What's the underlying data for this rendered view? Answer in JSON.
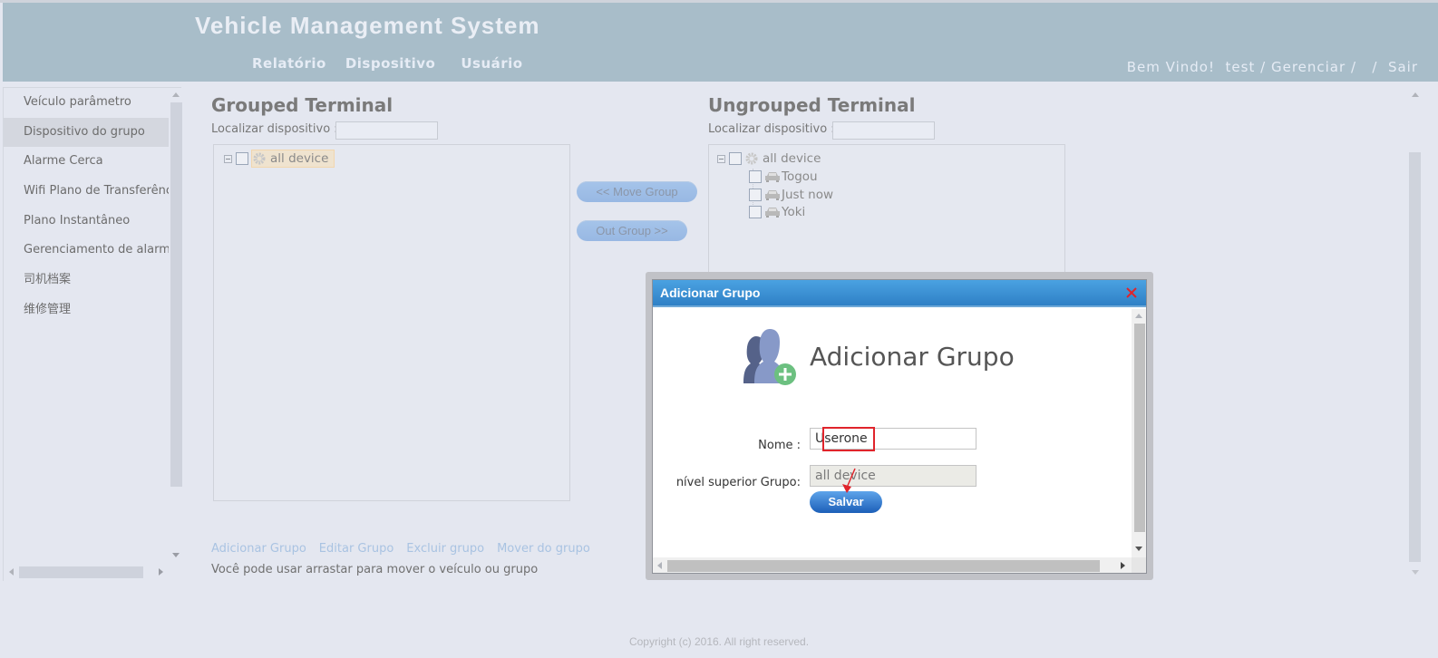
{
  "header": {
    "app_title": "Vehicle Management System",
    "nav": [
      "Relatório",
      "Dispositivo",
      "Usuário"
    ],
    "user_bar": {
      "welcome": "Bem Vindo!",
      "username": "test",
      "separator": "/",
      "manage": "Gerenciar",
      "logout": "Sair"
    }
  },
  "sidebar": {
    "active_index": 1,
    "items": [
      {
        "label": "Veículo parâmetro"
      },
      {
        "label": "Dispositivo do grupo"
      },
      {
        "label": "Alarme Cerca"
      },
      {
        "label": "Wifi Plano de Transferência"
      },
      {
        "label": "Plano Instantâneo"
      },
      {
        "label": "Gerenciamento de alarme"
      },
      {
        "label": "司机档案"
      },
      {
        "label": "维修管理"
      }
    ]
  },
  "grouped": {
    "title": "Grouped Terminal",
    "search_label": "Localizar dispositivo :",
    "search_value": "",
    "tree": {
      "root": "all device",
      "children": []
    }
  },
  "ungrouped": {
    "title": "Ungrouped Terminal",
    "search_label": "Localizar dispositivo :",
    "search_value": "",
    "tree": {
      "root": "all device",
      "children": [
        "Togou",
        "Just now",
        "Yoki"
      ]
    }
  },
  "actions": {
    "move_group": "<< Move Group",
    "out_group": "Out Group >>"
  },
  "bottom_links": [
    "Adicionar Grupo",
    "Editar Grupo",
    "Excluir grupo",
    "Mover do grupo"
  ],
  "hint": "Você pode usar arrastar para mover o veículo ou grupo",
  "footer": "Copyright (c) 2016. All right reserved.",
  "dialog": {
    "title": "Adicionar Grupo",
    "heading": "Adicionar Grupo",
    "name_label": "Nome :",
    "name_value": "Userone",
    "parent_label": "nível superior Grupo:",
    "parent_value": "all device",
    "save_label": "Salvar",
    "colors": {
      "titlebar": "#2f80c6",
      "close": "#e0242b",
      "highlight": "#e0242b"
    }
  }
}
